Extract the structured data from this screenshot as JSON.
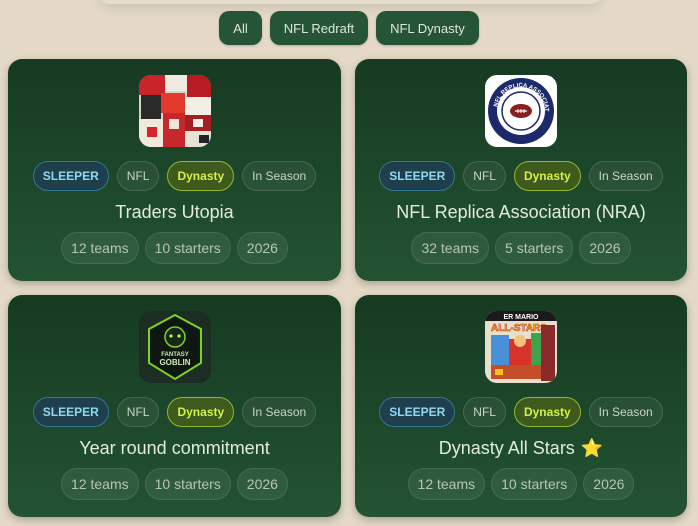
{
  "filters": [
    {
      "label": "All"
    },
    {
      "label": "NFL Redraft"
    },
    {
      "label": "NFL Dynasty"
    }
  ],
  "leagues": [
    {
      "name": "Traders Utopia",
      "logo": "sale-signs-image",
      "tags": [
        "SLEEPER",
        "NFL",
        "Dynasty",
        "In Season"
      ],
      "stats": [
        "12 teams",
        "10 starters",
        "2026"
      ]
    },
    {
      "name": "NFL Replica Association (NRA)",
      "logo": "nra-football-emblem",
      "logo_text": "NFL REPLICA ASSOCIATION",
      "tags": [
        "SLEEPER",
        "NFL",
        "Dynasty",
        "In Season"
      ],
      "stats": [
        "32 teams",
        "5 starters",
        "2026"
      ]
    },
    {
      "name": "Year round commitment",
      "logo": "fantasy-goblin-emblem",
      "logo_text": "FANTASY GOBLIN",
      "tags": [
        "SLEEPER",
        "NFL",
        "Dynasty",
        "In Season"
      ],
      "stats": [
        "12 teams",
        "10 starters",
        "2026"
      ]
    },
    {
      "name": "Dynasty All Stars",
      "emoji": "⭐",
      "logo": "mario-all-stars-cover",
      "logo_text": "ER MARIO ALL-STARS",
      "tags": [
        "SLEEPER",
        "NFL",
        "Dynasty",
        "In Season"
      ],
      "stats": [
        "12 teams",
        "10 starters",
        "2026"
      ]
    }
  ],
  "colors": {
    "page_bg": "#e3d9c6",
    "card_top": "#163a22",
    "card_bottom": "#235332",
    "filter_bg": "#255436",
    "platform_tag": "#8fd8f0",
    "type_tag": "#d4f04a"
  }
}
